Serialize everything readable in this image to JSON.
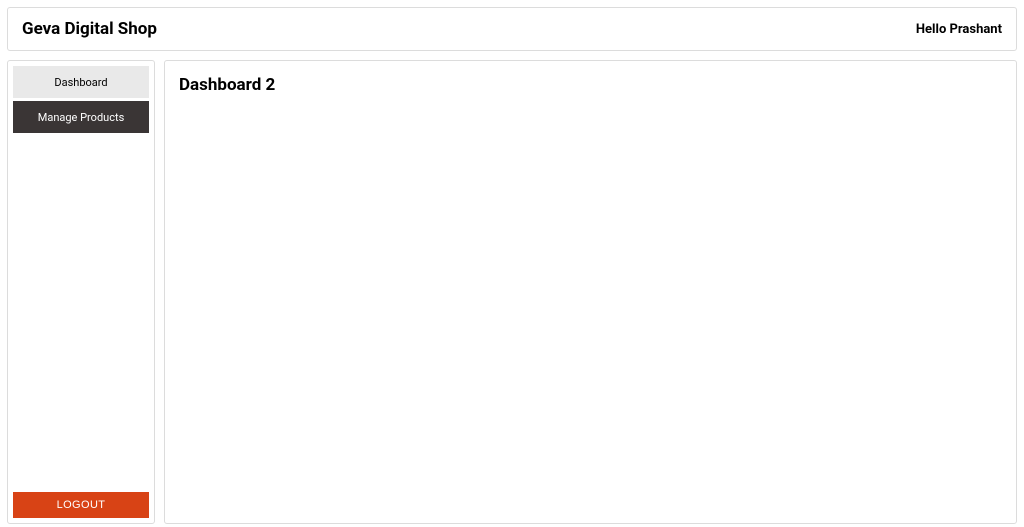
{
  "header": {
    "title": "Geva Digital Shop",
    "greeting": "Hello Prashant"
  },
  "sidebar": {
    "items": [
      {
        "label": "Dashboard",
        "active": true
      },
      {
        "label": "Manage Products",
        "active": false
      }
    ],
    "logout_label": "LOGOUT"
  },
  "main": {
    "title": "Dashboard 2"
  }
}
